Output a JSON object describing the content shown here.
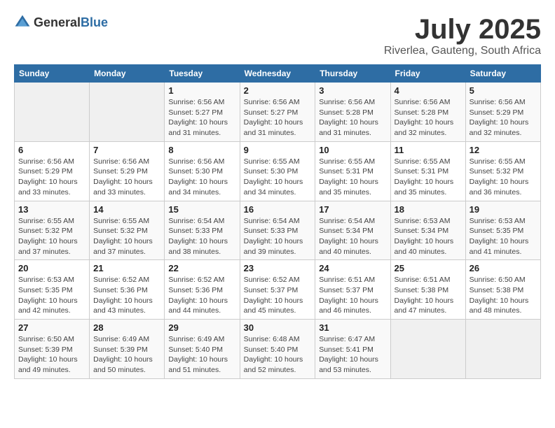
{
  "header": {
    "logo_general": "General",
    "logo_blue": "Blue",
    "title": "July 2025",
    "location": "Riverlea, Gauteng, South Africa"
  },
  "weekdays": [
    "Sunday",
    "Monday",
    "Tuesday",
    "Wednesday",
    "Thursday",
    "Friday",
    "Saturday"
  ],
  "weeks": [
    [
      {
        "day": "",
        "info": ""
      },
      {
        "day": "",
        "info": ""
      },
      {
        "day": "1",
        "info": "Sunrise: 6:56 AM\nSunset: 5:27 PM\nDaylight: 10 hours and 31 minutes."
      },
      {
        "day": "2",
        "info": "Sunrise: 6:56 AM\nSunset: 5:27 PM\nDaylight: 10 hours and 31 minutes."
      },
      {
        "day": "3",
        "info": "Sunrise: 6:56 AM\nSunset: 5:28 PM\nDaylight: 10 hours and 31 minutes."
      },
      {
        "day": "4",
        "info": "Sunrise: 6:56 AM\nSunset: 5:28 PM\nDaylight: 10 hours and 32 minutes."
      },
      {
        "day": "5",
        "info": "Sunrise: 6:56 AM\nSunset: 5:29 PM\nDaylight: 10 hours and 32 minutes."
      }
    ],
    [
      {
        "day": "6",
        "info": "Sunrise: 6:56 AM\nSunset: 5:29 PM\nDaylight: 10 hours and 33 minutes."
      },
      {
        "day": "7",
        "info": "Sunrise: 6:56 AM\nSunset: 5:29 PM\nDaylight: 10 hours and 33 minutes."
      },
      {
        "day": "8",
        "info": "Sunrise: 6:56 AM\nSunset: 5:30 PM\nDaylight: 10 hours and 34 minutes."
      },
      {
        "day": "9",
        "info": "Sunrise: 6:55 AM\nSunset: 5:30 PM\nDaylight: 10 hours and 34 minutes."
      },
      {
        "day": "10",
        "info": "Sunrise: 6:55 AM\nSunset: 5:31 PM\nDaylight: 10 hours and 35 minutes."
      },
      {
        "day": "11",
        "info": "Sunrise: 6:55 AM\nSunset: 5:31 PM\nDaylight: 10 hours and 35 minutes."
      },
      {
        "day": "12",
        "info": "Sunrise: 6:55 AM\nSunset: 5:32 PM\nDaylight: 10 hours and 36 minutes."
      }
    ],
    [
      {
        "day": "13",
        "info": "Sunrise: 6:55 AM\nSunset: 5:32 PM\nDaylight: 10 hours and 37 minutes."
      },
      {
        "day": "14",
        "info": "Sunrise: 6:55 AM\nSunset: 5:32 PM\nDaylight: 10 hours and 37 minutes."
      },
      {
        "day": "15",
        "info": "Sunrise: 6:54 AM\nSunset: 5:33 PM\nDaylight: 10 hours and 38 minutes."
      },
      {
        "day": "16",
        "info": "Sunrise: 6:54 AM\nSunset: 5:33 PM\nDaylight: 10 hours and 39 minutes."
      },
      {
        "day": "17",
        "info": "Sunrise: 6:54 AM\nSunset: 5:34 PM\nDaylight: 10 hours and 40 minutes."
      },
      {
        "day": "18",
        "info": "Sunrise: 6:53 AM\nSunset: 5:34 PM\nDaylight: 10 hours and 40 minutes."
      },
      {
        "day": "19",
        "info": "Sunrise: 6:53 AM\nSunset: 5:35 PM\nDaylight: 10 hours and 41 minutes."
      }
    ],
    [
      {
        "day": "20",
        "info": "Sunrise: 6:53 AM\nSunset: 5:35 PM\nDaylight: 10 hours and 42 minutes."
      },
      {
        "day": "21",
        "info": "Sunrise: 6:52 AM\nSunset: 5:36 PM\nDaylight: 10 hours and 43 minutes."
      },
      {
        "day": "22",
        "info": "Sunrise: 6:52 AM\nSunset: 5:36 PM\nDaylight: 10 hours and 44 minutes."
      },
      {
        "day": "23",
        "info": "Sunrise: 6:52 AM\nSunset: 5:37 PM\nDaylight: 10 hours and 45 minutes."
      },
      {
        "day": "24",
        "info": "Sunrise: 6:51 AM\nSunset: 5:37 PM\nDaylight: 10 hours and 46 minutes."
      },
      {
        "day": "25",
        "info": "Sunrise: 6:51 AM\nSunset: 5:38 PM\nDaylight: 10 hours and 47 minutes."
      },
      {
        "day": "26",
        "info": "Sunrise: 6:50 AM\nSunset: 5:38 PM\nDaylight: 10 hours and 48 minutes."
      }
    ],
    [
      {
        "day": "27",
        "info": "Sunrise: 6:50 AM\nSunset: 5:39 PM\nDaylight: 10 hours and 49 minutes."
      },
      {
        "day": "28",
        "info": "Sunrise: 6:49 AM\nSunset: 5:39 PM\nDaylight: 10 hours and 50 minutes."
      },
      {
        "day": "29",
        "info": "Sunrise: 6:49 AM\nSunset: 5:40 PM\nDaylight: 10 hours and 51 minutes."
      },
      {
        "day": "30",
        "info": "Sunrise: 6:48 AM\nSunset: 5:40 PM\nDaylight: 10 hours and 52 minutes."
      },
      {
        "day": "31",
        "info": "Sunrise: 6:47 AM\nSunset: 5:41 PM\nDaylight: 10 hours and 53 minutes."
      },
      {
        "day": "",
        "info": ""
      },
      {
        "day": "",
        "info": ""
      }
    ]
  ]
}
